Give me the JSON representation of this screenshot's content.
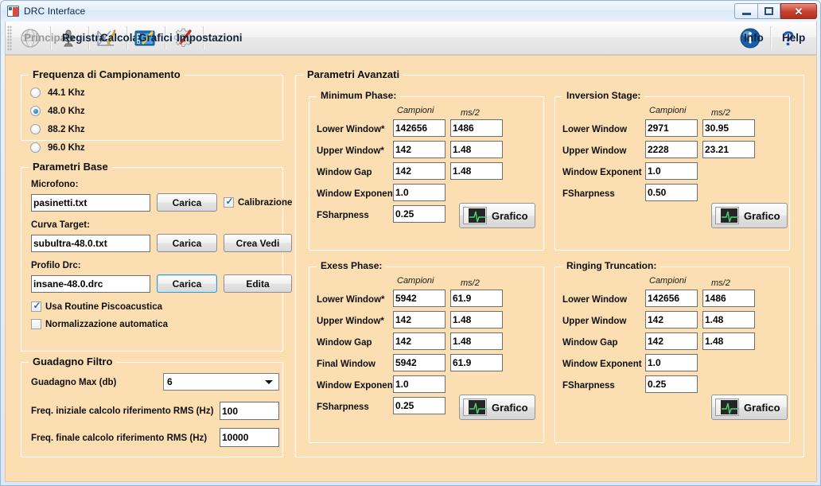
{
  "window": {
    "title": "DRC Interface",
    "icon": "app-icon",
    "controls": {
      "minimize": "–",
      "maximize": "□",
      "close": "✕"
    }
  },
  "toolbar": {
    "items": [
      {
        "label": "Principale",
        "icon": "globe-icon",
        "disabled": true
      },
      {
        "label": "Registra",
        "icon": "microphone-icon",
        "disabled": false
      },
      {
        "label": "Calcola",
        "icon": "ruler-pencil-icon",
        "disabled": false
      },
      {
        "label": "Grafici",
        "icon": "chart-edit-icon",
        "disabled": false
      },
      {
        "label": "Impostazioni",
        "icon": "gear-screwdriver-icon",
        "disabled": false
      }
    ],
    "right_items": [
      {
        "label": "Info",
        "icon": "info-icon"
      },
      {
        "label": "Help",
        "icon": "question-mark-icon"
      }
    ]
  },
  "sampling": {
    "title": "Frequenza di Campionamento",
    "options": [
      {
        "label": "44.1 Khz",
        "selected": false
      },
      {
        "label": "48.0 Khz",
        "selected": true
      },
      {
        "label": "88.2 Khz",
        "selected": false
      },
      {
        "label": "96.0 Khz",
        "selected": false
      }
    ]
  },
  "base_params": {
    "title": "Parametri Base",
    "microphone": {
      "label": "Microfono:",
      "value": "pasinetti.txt",
      "load_button": "Carica",
      "calibration": {
        "label": "Calibrazione",
        "checked": true
      }
    },
    "target_curve": {
      "label": "Curva Target:",
      "value": "subultra-48.0.txt",
      "load_button": "Carica",
      "create_button": "Crea Vedi"
    },
    "drc_profile": {
      "label": "Profilo Drc:",
      "value": "insane-48.0.drc",
      "load_button": "Carica",
      "edit_button": "Edita"
    },
    "checkboxes": [
      {
        "label": "Usa Routine Piscoacustica",
        "checked": true
      },
      {
        "label": "Normalizzazione automatica",
        "checked": false
      }
    ]
  },
  "filter_gain": {
    "title": "Guadagno Filtro",
    "max_gain": {
      "label": "Guadagno Max (db)",
      "value": "6"
    },
    "rms_start": {
      "label": "Freq. iniziale calcolo riferimento RMS (Hz)",
      "value": "100"
    },
    "rms_end": {
      "label": "Freq. finale calcolo riferimento RMS (Hz)",
      "value": "10000"
    }
  },
  "advanced": {
    "title": "Parametri Avanzati",
    "col_headers": {
      "samples": "Campioni",
      "ms": "ms/2"
    },
    "graph_button": "Grafico",
    "panels": [
      {
        "title": "Minimum Phase:",
        "rows": [
          {
            "label": "Lower Window*",
            "samples": "142656",
            "ms": "1486"
          },
          {
            "label": "Upper Window*",
            "samples": "142",
            "ms": "1.48"
          },
          {
            "label": "Window Gap",
            "samples": "142",
            "ms": "1.48"
          },
          {
            "label": "Window Exponent",
            "samples": "1.0",
            "ms": ""
          },
          {
            "label": "FSharpness",
            "samples": "0.25",
            "ms": ""
          }
        ]
      },
      {
        "title": "Inversion Stage:",
        "rows": [
          {
            "label": "Lower Window",
            "samples": "2971",
            "ms": "30.95"
          },
          {
            "label": "Upper Window",
            "samples": "2228",
            "ms": "23.21"
          },
          {
            "label": "Window Exponent",
            "samples": "1.0",
            "ms": ""
          },
          {
            "label": "FSharpness",
            "samples": "0.50",
            "ms": ""
          }
        ]
      },
      {
        "title": "Exess Phase:",
        "rows": [
          {
            "label": "Lower Window*",
            "samples": "5942",
            "ms": "61.9"
          },
          {
            "label": "Upper Window*",
            "samples": "142",
            "ms": "1.48"
          },
          {
            "label": "Window Gap",
            "samples": "142",
            "ms": "1.48"
          },
          {
            "label": "Final Window",
            "samples": "5942",
            "ms": "61.9"
          },
          {
            "label": "Window Exponent",
            "samples": "1.0",
            "ms": ""
          },
          {
            "label": "FSharpness",
            "samples": "0.25",
            "ms": ""
          }
        ]
      },
      {
        "title": "Ringing Truncation:",
        "rows": [
          {
            "label": "Lower Window",
            "samples": "142656",
            "ms": "1486"
          },
          {
            "label": "Upper Window",
            "samples": "142",
            "ms": "1.48"
          },
          {
            "label": "Window Gap",
            "samples": "142",
            "ms": "1.48"
          },
          {
            "label": "Window Exponent",
            "samples": "1.0",
            "ms": ""
          },
          {
            "label": "FSharpness",
            "samples": "0.25",
            "ms": ""
          }
        ]
      }
    ]
  },
  "colors": {
    "client_background": "#fbdeb1",
    "accent_blue": "#0a6fbd",
    "close_red": "#c7402c",
    "waveform_green": "#4cd47a"
  }
}
